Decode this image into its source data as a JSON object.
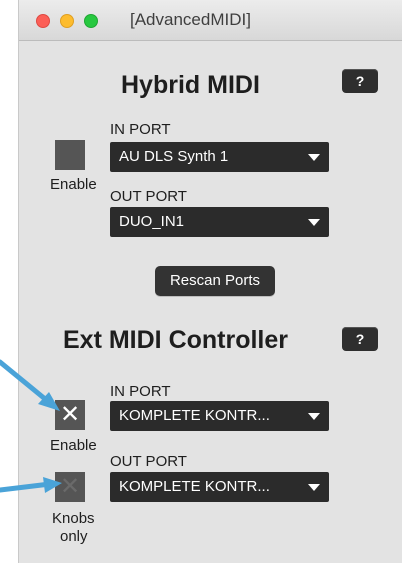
{
  "window": {
    "title": "[AdvancedMIDI]"
  },
  "hybrid": {
    "heading": "Hybrid MIDI",
    "help_label": "?",
    "enable_label": "Enable",
    "in_port_label": "IN PORT",
    "in_port_value": "AU DLS Synth 1",
    "out_port_label": "OUT PORT",
    "out_port_value": "DUO_IN1",
    "rescan_label": "Rescan Ports"
  },
  "ext": {
    "heading": "Ext MIDI Controller",
    "help_label": "?",
    "enable_label": "Enable",
    "enable_mark": "✕",
    "knobs_label_line1": "Knobs",
    "knobs_label_line2": "only",
    "knobs_mark": "✕",
    "in_port_label": "IN PORT",
    "in_port_value": "KOMPLETE KONTR...",
    "out_port_label": "OUT PORT",
    "out_port_value": "KOMPLETE KONTR..."
  },
  "colors": {
    "arrow": "#4aa3d8",
    "panel": "#e3e3e3",
    "control": "#2b2b2b"
  }
}
